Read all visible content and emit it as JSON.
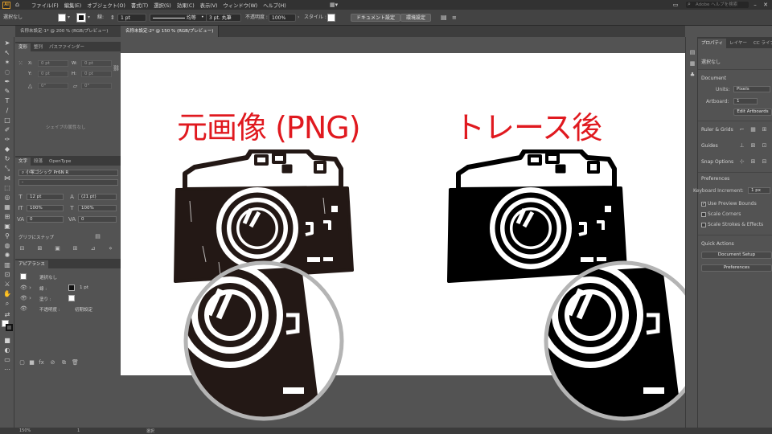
{
  "app": {
    "logo": "Ai",
    "menus": [
      "ファイル(F)",
      "編集(E)",
      "オブジェクト(O)",
      "書式(T)",
      "選択(S)",
      "効果(C)",
      "表示(V)",
      "ウィンドウ(W)",
      "ヘルプ(H)"
    ],
    "search_placeholder": "Adobe ヘルプを検索"
  },
  "controlbar": {
    "selection_status": "選択なし",
    "stroke_weight": "1 pt",
    "profile": "均等",
    "brush": "3 pt. 丸筆",
    "opacity_label": "不透明度 :",
    "opacity_value": "100%",
    "style_label": "スタイル :",
    "doc_setup_button": "ドキュメント設定",
    "prefs_button": "環境設定"
  },
  "document_tabs": {
    "left": "名称未設定-1* @ 200 % (RGB/プレビュー)",
    "tabs": [
      {
        "label": "名称未設定-1* @ 200 % (RGB/プレビュー)"
      },
      {
        "label": "名称未設定-2* @ 150 % (RGB/プレビュー)"
      }
    ]
  },
  "left_panels": {
    "transform": {
      "tabs": [
        "変形",
        "整列",
        "パスファインダー"
      ],
      "x": "0 pt",
      "y": "0 pt",
      "w": "0 pt",
      "h": "0 pt",
      "angle": "0°",
      "shear": "0°",
      "footer": "シェイプの属性なし"
    },
    "character": {
      "tabs": [
        "文字",
        "段落",
        "OpenType"
      ],
      "font_family": "小塚ゴシック Pr6N R",
      "font_style": "-",
      "size": "12 pt",
      "leading": "(21 pt)",
      "h_scale": "100%",
      "v_scale": "100%",
      "kerning": "0",
      "tracking": "0",
      "snap_label": "グリフにスナップ"
    },
    "appearance": {
      "tab": "アピアランス",
      "selection": "選択なし",
      "stroke_label": "線 :",
      "stroke_value": "1 pt",
      "fill_label": "塗り :",
      "opacity_label": "不透明度 :",
      "opacity_value": "初期設定"
    }
  },
  "canvas": {
    "left_heading": "元画像 (PNG)",
    "right_heading": "トレース後"
  },
  "properties_panel": {
    "tabs": [
      "プロパティ",
      "レイヤー",
      "CC ライブラ"
    ],
    "selection": "選択なし",
    "document_label": "Document",
    "units_label": "Units:",
    "units_value": "Pixels",
    "artboard_label": "Artboard:",
    "artboard_value": "1",
    "edit_artboards_button": "Edit Artboards",
    "ruler_grids_label": "Ruler & Grids",
    "guides_label": "Guides",
    "snap_options_label": "Snap Options",
    "preferences_label": "Preferences",
    "keyboard_increment_label": "Keyboard Increment:",
    "keyboard_increment_value": "1 px",
    "use_preview_bounds": "Use Preview Bounds",
    "scale_corners": "Scale Corners",
    "scale_strokes": "Scale Strokes & Effects",
    "quick_actions_label": "Quick Actions",
    "document_setup_button": "Document Setup",
    "preferences_button": "Preferences"
  },
  "statusbar": {
    "zoom": "150%",
    "page": "1",
    "mode": "選択"
  },
  "colors": {
    "heading_red": "#e0191f",
    "panel_bg": "#535353",
    "menubar_bg": "#323232"
  }
}
